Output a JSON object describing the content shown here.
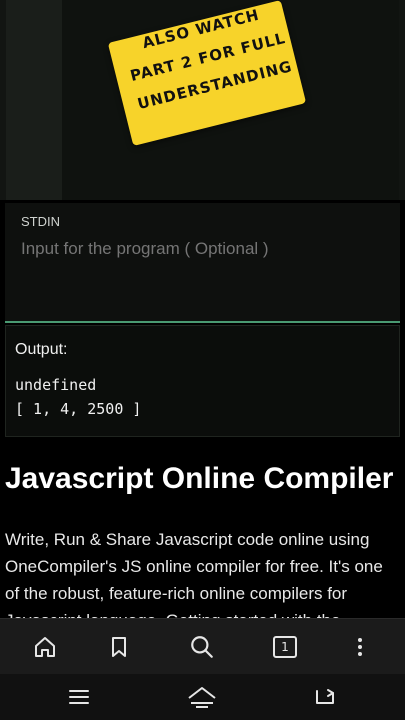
{
  "sticker": {
    "lines": [
      "ALSO WATCH",
      "PART 2 FOR FULL",
      "UNDERSTANDING"
    ]
  },
  "stdin": {
    "label": "STDIN",
    "placeholder": "Input for the program ( Optional )"
  },
  "output": {
    "label": "Output:",
    "lines": [
      "undefined",
      "[ 1, 4, 2500 ]"
    ]
  },
  "article": {
    "heading": "Javascript Online Compiler",
    "paragraph": "Write, Run & Share Javascript code online using OneCompiler's JS online compiler for free. It's one of the robust, feature-rich online compilers for Javascript language. Getting started with the"
  },
  "browser_toolbar": {
    "tab_count": "1",
    "icons": [
      "home-icon",
      "bookmark-icon",
      "search-icon",
      "tabs-icon",
      "more-vert-icon"
    ]
  },
  "system_nav": {
    "icons": [
      "recents-icon",
      "home-nav-icon",
      "back-icon"
    ]
  }
}
